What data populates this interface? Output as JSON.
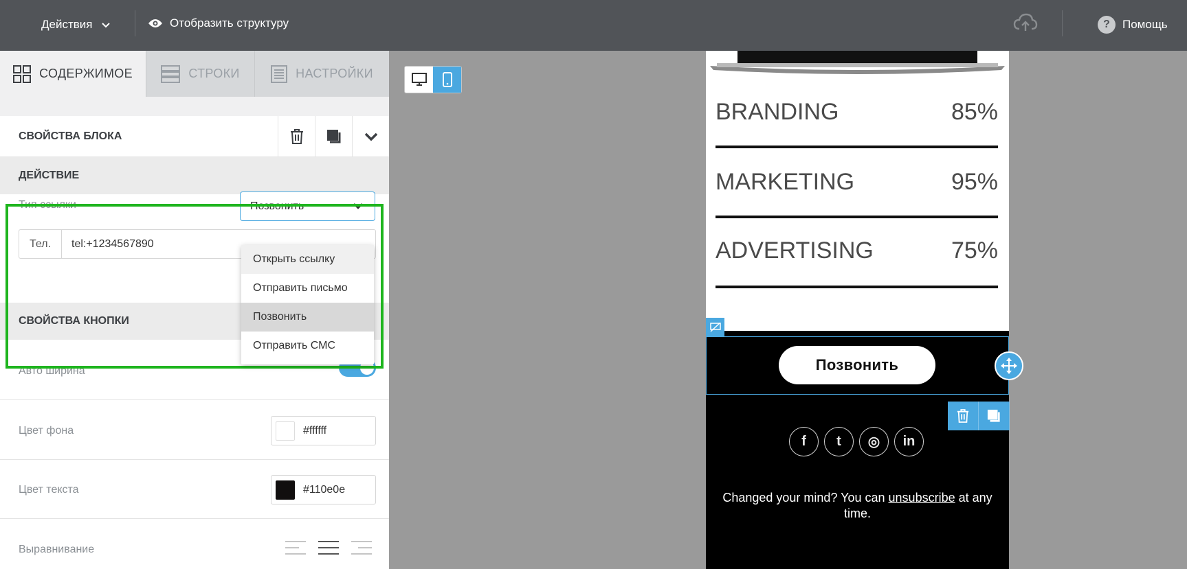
{
  "topbar": {
    "actions_label": "Действия",
    "structure_label": "Отобразить структуру",
    "help_label": "Помощь",
    "help_glyph": "?"
  },
  "tabs": [
    {
      "label": "СОДЕРЖИМОЕ",
      "icon": "grid-icon",
      "active": true
    },
    {
      "label": "СТРОКИ",
      "icon": "rows-icon",
      "active": false
    },
    {
      "label": "НАСТРОЙКИ",
      "icon": "settings-doc-icon",
      "active": false
    }
  ],
  "block": {
    "title": "СВОЙСТВА БЛОКА",
    "action_section": "ДЕЙСТВИЕ",
    "link_type_label": "Тип ссылки",
    "link_type_value": "Позвонить",
    "phone_prefix": "Тел.",
    "phone_value": "tel:+1234567890",
    "button_section": "СВОЙСТВА КНОПКИ",
    "auto_width_label": "Авто ширина",
    "auto_width_on": true,
    "bg_color_label": "Цвет фона",
    "bg_color_value": "#ffffff",
    "text_color_label": "Цвет текста",
    "text_color_value": "#110e0e",
    "align_label": "Выравнивание"
  },
  "dropdown": {
    "options": [
      "Открыть ссылку",
      "Отправить письмо",
      "Позвонить",
      "Отправить СМС"
    ],
    "selected": "Позвонить"
  },
  "email": {
    "skills": [
      {
        "name": "BRANDING",
        "pct": "85%"
      },
      {
        "name": "MARKETING",
        "pct": "95%"
      },
      {
        "name": "ADVERTISING",
        "pct": "75%"
      }
    ],
    "cta_label": "Позвонить",
    "footer_pre": "Changed your mind? You can ",
    "footer_link": "unsubscribe",
    "footer_post": " at any time.",
    "social": [
      {
        "icon": "facebook-icon",
        "glyph": "f"
      },
      {
        "icon": "twitter-icon",
        "glyph": "t"
      },
      {
        "icon": "instagram-icon",
        "glyph": "◎"
      },
      {
        "icon": "linkedin-icon",
        "glyph": "in"
      }
    ]
  },
  "colors": {
    "accent": "#4aa8e0",
    "highlight": "#1eb51e",
    "topbar": "#515458"
  }
}
